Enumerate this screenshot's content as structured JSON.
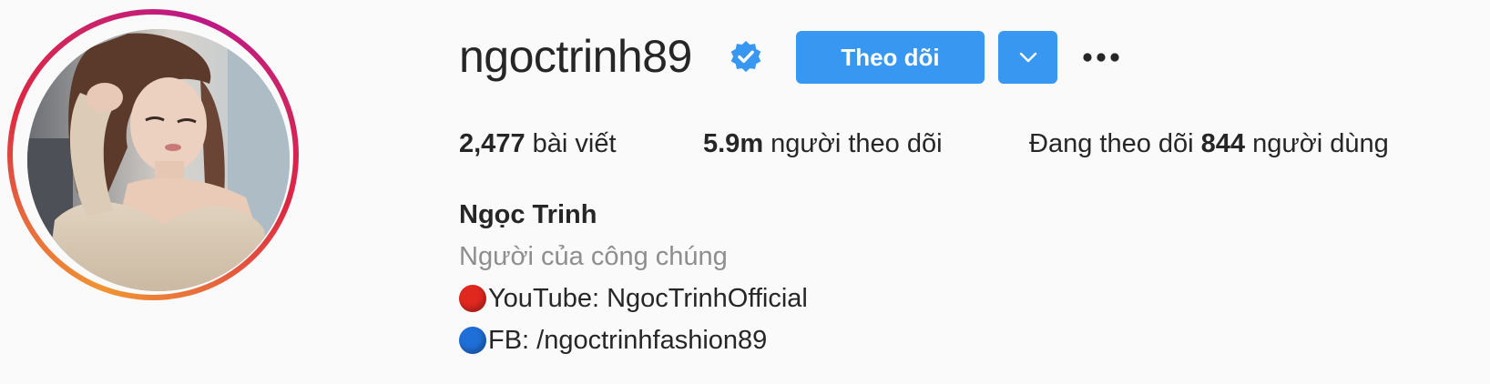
{
  "profile": {
    "username": "ngoctrinh89",
    "verified": true,
    "follow_label": "Theo dõi",
    "full_name": "Ngọc Trinh",
    "category": "Người của công chúng"
  },
  "stats": {
    "posts_count": "2,477",
    "posts_label": "bài viết",
    "followers_count": "5.9m",
    "followers_label": "người theo dõi",
    "following_prefix": "Đang theo dõi",
    "following_count": "844",
    "following_suffix": "người dùng"
  },
  "bio": [
    {
      "icon": "red-circle-icon",
      "color": "#e0281f",
      "text": "YouTube: NgocTrinhOfficial"
    },
    {
      "icon": "blue-circle-icon",
      "color": "#1f6fd8",
      "text": "FB: /ngoctrinhfashion89"
    }
  ],
  "colors": {
    "primary_button": "#3897f0",
    "verified_badge": "#3897f0",
    "secondary_text": "#8e8e8e",
    "text": "#262626",
    "background": "#fafafa"
  },
  "icons": {
    "verified": "verified-badge-icon",
    "dropdown": "chevron-down-icon",
    "more": "more-options-icon"
  }
}
